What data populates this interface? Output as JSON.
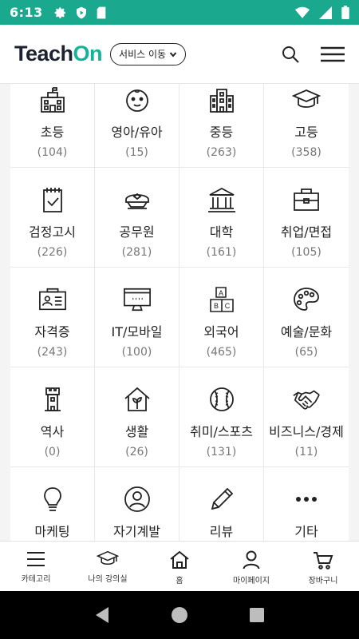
{
  "status_bar": {
    "time": "6:13"
  },
  "header": {
    "logo_teach": "Teach",
    "logo_on": "On",
    "service_button": "서비스 이동"
  },
  "categories": [
    {
      "name": "초등",
      "count": "(104)",
      "icon": "elementary-school-icon"
    },
    {
      "name": "영아/유아",
      "count": "(15)",
      "icon": "baby-face-icon"
    },
    {
      "name": "중등",
      "count": "(263)",
      "icon": "secondary-school-icon"
    },
    {
      "name": "고등",
      "count": "(358)",
      "icon": "graduation-cap-icon"
    },
    {
      "name": "검정고시",
      "count": "(226)",
      "icon": "checked-calendar-icon"
    },
    {
      "name": "공무원",
      "count": "(281)",
      "icon": "officer-cap-icon"
    },
    {
      "name": "대학",
      "count": "(161)",
      "icon": "university-building-icon"
    },
    {
      "name": "취업/면접",
      "count": "(105)",
      "icon": "briefcase-icon"
    },
    {
      "name": "자격증",
      "count": "(243)",
      "icon": "id-card-icon"
    },
    {
      "name": "IT/모바일",
      "count": "(100)",
      "icon": "monitor-icon"
    },
    {
      "name": "외국어",
      "count": "(465)",
      "icon": "abc-blocks-icon"
    },
    {
      "name": "예술/문화",
      "count": "(65)",
      "icon": "palette-icon"
    },
    {
      "name": "역사",
      "count": "(0)",
      "icon": "tower-icon"
    },
    {
      "name": "생활",
      "count": "(26)",
      "icon": "house-sprout-icon"
    },
    {
      "name": "취미/스포츠",
      "count": "(131)",
      "icon": "baseball-icon"
    },
    {
      "name": "비즈니스/경제",
      "count": "(11)",
      "icon": "handshake-icon"
    },
    {
      "name": "마케팅",
      "count": "",
      "icon": "lightbulb-icon"
    },
    {
      "name": "자기계발",
      "count": "",
      "icon": "person-circle-icon"
    },
    {
      "name": "리뷰",
      "count": "",
      "icon": "pencil-icon"
    },
    {
      "name": "기타",
      "count": "",
      "icon": "more-dots-icon"
    }
  ],
  "bottom_nav": [
    {
      "label": "카테고리",
      "icon": "menu-icon"
    },
    {
      "label": "나의 강의실",
      "icon": "graduation-cap-icon"
    },
    {
      "label": "홈",
      "icon": "home-icon"
    },
    {
      "label": "마이페이지",
      "icon": "person-icon"
    },
    {
      "label": "장바구니",
      "icon": "cart-icon"
    }
  ],
  "colors": {
    "status_bar": "#1aa88f",
    "brand_on": "#13b29a"
  }
}
